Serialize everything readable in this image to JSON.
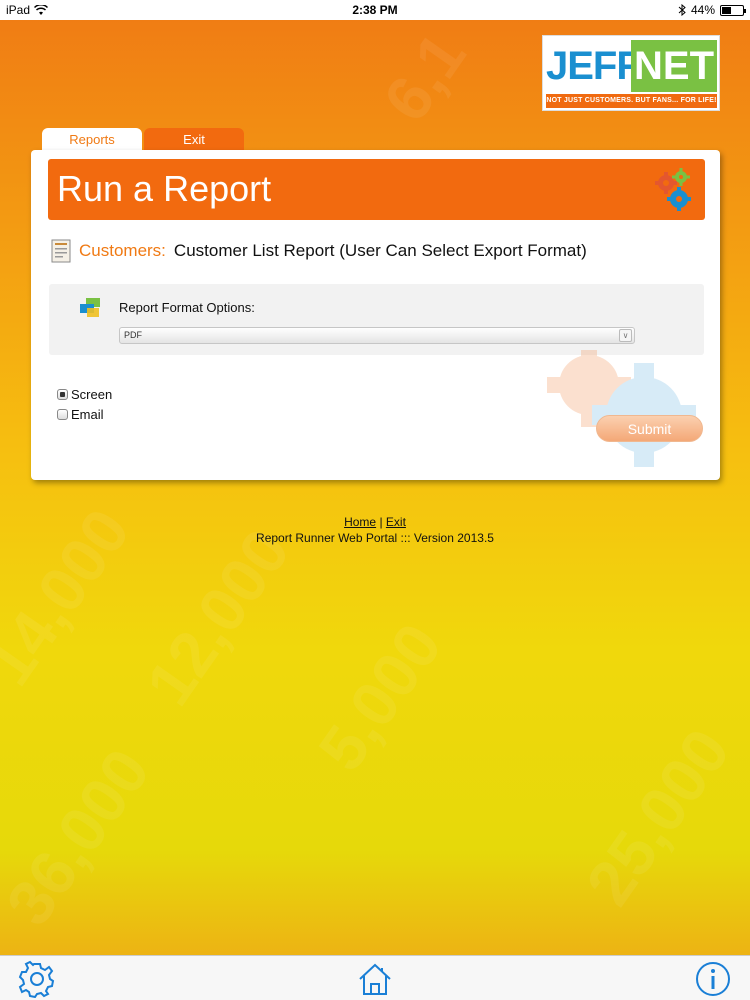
{
  "status_bar": {
    "device": "iPad",
    "time": "2:38 PM",
    "battery": "44%",
    "battery_level": 0.44
  },
  "logo": {
    "jeff": "JEFF",
    "net": "NET",
    "tagline": "NOT JUST CUSTOMERS. BUT FANS... FOR LIFE!"
  },
  "tabs": [
    {
      "label": "Reports",
      "active": true
    },
    {
      "label": "Exit",
      "active": false
    }
  ],
  "panel": {
    "title": "Run a Report",
    "category": "Customers:",
    "report_name": "Customer List Report (User Can Select Export Format)",
    "format_label": "Report Format Options:",
    "format_selected": "PDF",
    "output_options": [
      {
        "label": "Screen",
        "checked": true
      },
      {
        "label": "Email",
        "checked": false
      }
    ],
    "submit_label": "Submit"
  },
  "footer": {
    "home_link": "Home",
    "separator": "|",
    "exit_link": "Exit",
    "version_text": "Report Runner Web Portal ::: Version 2013.5"
  },
  "toolbar": {
    "icons": [
      "gear-icon",
      "home-icon",
      "info-icon"
    ]
  },
  "colors": {
    "accent_orange": "#f26a0f",
    "logo_blue": "#1a8fd0",
    "logo_green": "#7ac143",
    "tool_icon_blue": "#1a7fd6"
  }
}
